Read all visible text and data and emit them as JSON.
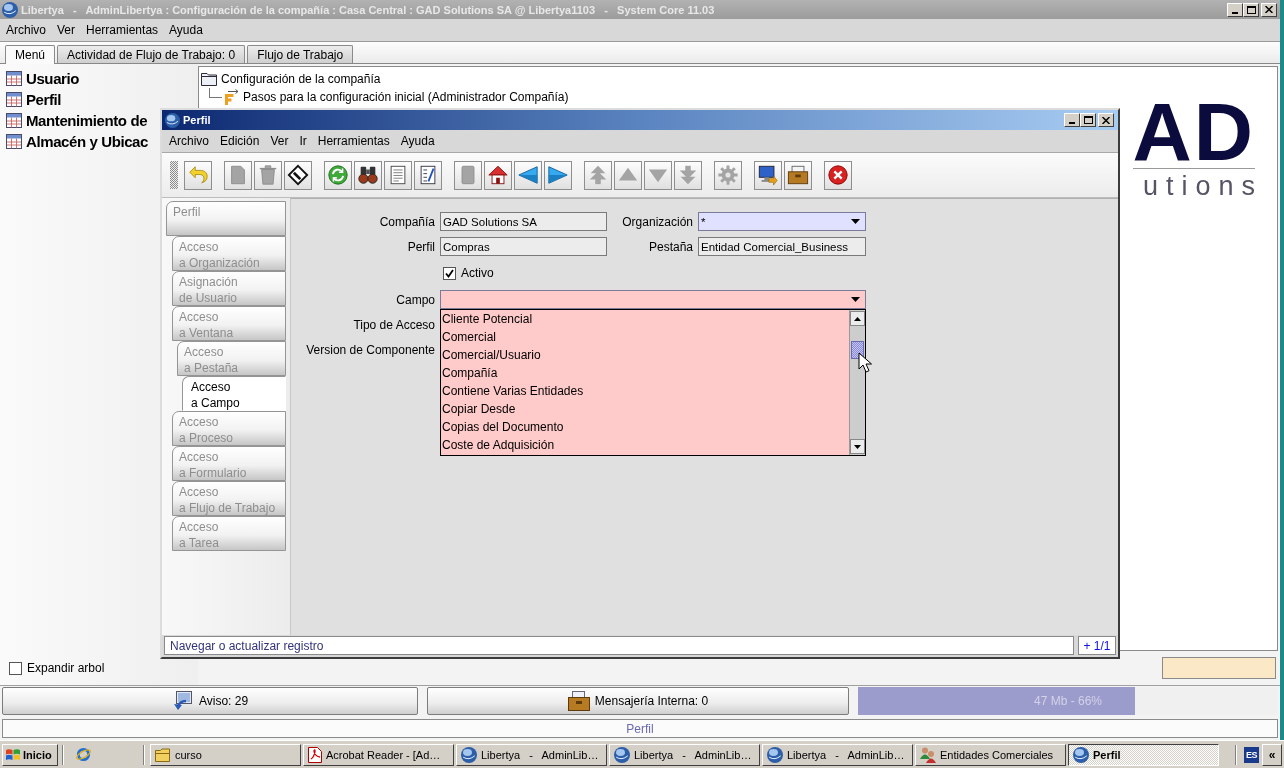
{
  "window": {
    "title": "Libertya   -   AdminLibertya : Configuración de la compañía : Casa Central : GAD Solutions SA @ Libertya1103   -   System Core 11.03"
  },
  "menu": [
    "Archivo",
    "Ver",
    "Herramientas",
    "Ayuda"
  ],
  "tabs": [
    {
      "label": "Menú",
      "selected": true
    },
    {
      "label": "Actividad de Flujo de Trabajo: 0",
      "selected": false
    },
    {
      "label": "Flujo de Trabajo",
      "selected": false
    }
  ],
  "favorites": [
    "Usuario",
    "Perfil",
    "Mantenimiento de",
    "Almacén y Ubicac"
  ],
  "menu_tree": [
    {
      "label": "Configuración de la compañía",
      "kind": "folder",
      "children": [
        {
          "label": "Pasos para la configuración inicial (Administrador Compañía)",
          "kind": "workflow"
        }
      ]
    }
  ],
  "logo": {
    "mark": "AD",
    "tagline": "utions"
  },
  "expand_tree": {
    "label": "Expandir arbol",
    "checked": false
  },
  "profile_window": {
    "title": "Perfil",
    "menu": [
      "Archivo",
      "Edición",
      "Ver",
      "Ir",
      "Herramientas",
      "Ayuda"
    ],
    "toolbar": [
      [
        {
          "kind": "undo",
          "disabled": false
        }
      ],
      [
        {
          "kind": "new",
          "disabled": true
        },
        {
          "kind": "delete",
          "disabled": true
        },
        {
          "kind": "save",
          "disabled": false
        }
      ],
      [
        {
          "kind": "refresh",
          "disabled": false
        },
        {
          "kind": "find",
          "disabled": false
        },
        {
          "kind": "detail",
          "disabled": false
        },
        {
          "kind": "grid",
          "disabled": false
        }
      ],
      [
        {
          "kind": "attachment",
          "disabled": true
        },
        {
          "kind": "home",
          "disabled": false
        },
        {
          "kind": "back",
          "disabled": false
        },
        {
          "kind": "forward",
          "disabled": false
        }
      ],
      [
        {
          "kind": "first",
          "disabled": true
        },
        {
          "kind": "previous",
          "disabled": true
        },
        {
          "kind": "next",
          "disabled": true
        },
        {
          "kind": "last",
          "disabled": true
        }
      ],
      [
        {
          "kind": "report",
          "disabled": true
        }
      ],
      [
        {
          "kind": "zoom",
          "disabled": false
        },
        {
          "kind": "archive",
          "disabled": false
        }
      ],
      [
        {
          "kind": "close",
          "disabled": false
        }
      ]
    ],
    "tabs": [
      {
        "label": "Perfil",
        "selected": false,
        "children": [
          {
            "label": "Acceso\na Organización",
            "selected": false
          },
          {
            "label": "Asignación\nde Usuario",
            "selected": false
          },
          {
            "label": "Acceso\na Ventana",
            "selected": false,
            "children": [
              {
                "label": "Acceso\na Pestaña",
                "selected": false,
                "children": [
                  {
                    "label": "Acceso\na Campo",
                    "selected": true
                  }
                ]
              }
            ]
          },
          {
            "label": "Acceso\na Proceso",
            "selected": false
          },
          {
            "label": "Acceso\na Formulario",
            "selected": false
          },
          {
            "label": "Acceso\na Flujo de Trabajo",
            "selected": false
          },
          {
            "label": "Acceso\na Tarea",
            "selected": false
          }
        ]
      }
    ],
    "field_rows": [
      [
        {
          "kind": "text",
          "label": "Compañía",
          "value": "GAD Solutions SA",
          "readonly": true
        },
        {
          "kind": "combo",
          "label": "Organización",
          "value": "*",
          "mandatory": true
        }
      ],
      [
        {
          "kind": "text",
          "label": "Perfil",
          "value": "Compras",
          "readonly": true
        },
        {
          "kind": "text",
          "label": "Pestaña",
          "value": "Entidad Comercial_Business",
          "readonly": true
        }
      ],
      [
        {
          "kind": "checkbox",
          "label": "Activo",
          "checked": true
        }
      ],
      [
        {
          "kind": "combo",
          "label": "Campo",
          "error": true,
          "expanded": true,
          "options": [
            {
              "label": "Cliente Potencial",
              "selected": false
            },
            {
              "label": "Comercial",
              "selected": false
            },
            {
              "label": "Comercial/Usuario",
              "selected": false
            },
            {
              "label": "Compañía",
              "selected": false
            },
            {
              "label": "Contiene Varias Entidades",
              "selected": false
            },
            {
              "label": "Copiar Desde",
              "selected": false
            },
            {
              "label": "Copias del Documento",
              "selected": false
            },
            {
              "label": "Coste de Adquisición",
              "selected": false
            }
          ]
        }
      ],
      [
        {
          "kind": "label",
          "label": "Tipo de Acceso"
        }
      ],
      [
        {
          "kind": "label",
          "label": "Version de Componente"
        }
      ]
    ],
    "status_bar": {
      "message": "Navegar o actualizar registro",
      "record": "+ 1/1"
    }
  },
  "bottom_bar": {
    "notices": "Aviso: 29",
    "messages": "Mensajería Interna: 0",
    "memory": {
      "level": 0.66,
      "reading": "47 Mb - 66%"
    }
  },
  "status_line": "Perfil",
  "taskbar": {
    "start": "Inicio",
    "tasks": [
      {
        "label": "curso",
        "kind": "folder",
        "selected": false
      },
      {
        "label": "Acrobat Reader - [Ad…",
        "kind": "reader",
        "selected": false
      },
      {
        "label": "Libertya   -   AdminLib…",
        "kind": "libertya",
        "selected": false
      },
      {
        "label": "Libertya   -   AdminLib…",
        "kind": "libertya",
        "selected": false
      },
      {
        "label": "Libertya   -   AdminLib…",
        "kind": "libertya",
        "selected": false
      },
      {
        "label": "Entidades Comerciales",
        "kind": "people",
        "selected": false
      },
      {
        "label": "Perfil",
        "kind": "libertya",
        "selected": true
      }
    ],
    "language": "ES",
    "collapse": "«"
  }
}
